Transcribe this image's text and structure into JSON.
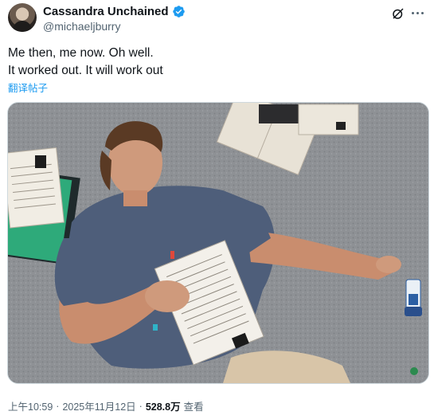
{
  "author": {
    "display_name": "Cassandra Unchained",
    "handle": "@michaeljburry",
    "verified_icon": "verified-badge-icon",
    "accent": "#1d9bf0"
  },
  "tweet": {
    "lines": [
      "Me then, me now. Oh well.",
      "It worked out. It will work out"
    ],
    "translate_label": "翻译帖子"
  },
  "meta": {
    "time": "上午10:59",
    "separator": "·",
    "date": "2025年11月12日",
    "views_count": "528.8万",
    "views_label": "查看"
  },
  "icons": [
    "grok-icon",
    "more-icon"
  ]
}
